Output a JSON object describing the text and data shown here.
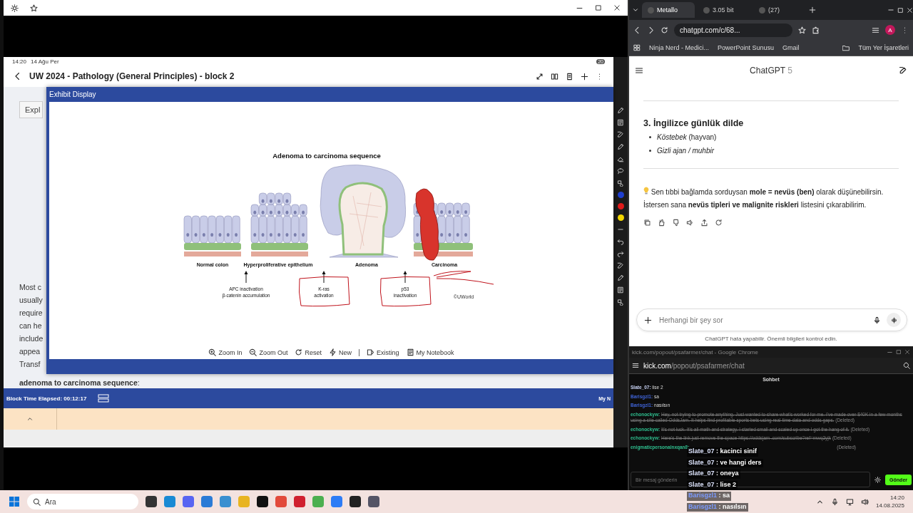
{
  "left_window": {
    "tablet_status": {
      "time": "14:20",
      "date": "14 Ağu Per",
      "battery": "20"
    },
    "app_bar": {
      "title": "UW 2024 - Pathology (General Principles) - block 2"
    },
    "question": {
      "button": "Expl",
      "lines": [
        "Most c",
        "usually",
        "require",
        "can he",
        "include",
        "appea",
        "Transf",
        "**adenoma to carcinoma sequence**:"
      ]
    },
    "exhibit": {
      "title": "Exhibit Display",
      "figure": {
        "title": "Adenoma to carcinoma sequence",
        "stages": [
          {
            "label": "Normal colon",
            "kind": "normal"
          },
          {
            "label": "Hyperproliferative epithelium",
            "kind": "hyperplastic"
          },
          {
            "label": "Adenoma",
            "kind": "adenoma"
          },
          {
            "label": "Carcinoma",
            "kind": "carcinoma"
          }
        ],
        "mutations": [
          {
            "lines": [
              "APC inactivation",
              "β-catenin accumulation"
            ],
            "circled": false
          },
          {
            "lines": [
              "K-ras",
              "activation"
            ],
            "circled": true
          },
          {
            "lines": [
              "p53",
              "inactivation"
            ],
            "circled": true
          }
        ],
        "credit": "©UWorld"
      },
      "toolbar": [
        {
          "label": "Zoom In",
          "kind": "zoom-in"
        },
        {
          "label": "Zoom Out",
          "kind": "zoom-out"
        },
        {
          "label": "Reset",
          "kind": "reset"
        },
        {
          "label": "New",
          "kind": "new"
        },
        {
          "label": "Existing",
          "kind": "existing"
        },
        {
          "label": "My Notebook",
          "kind": "notebook"
        }
      ]
    },
    "footer": {
      "elapsed": "Block Time Elapsed: 00:12:17",
      "right": "My N"
    },
    "pen_colors": [
      {
        "color": "#1f3fd0"
      },
      {
        "color": "#e01b1b"
      },
      {
        "color": "#f2d600"
      }
    ]
  },
  "browser": {
    "tabs": [
      {
        "label": "Metallo",
        "selected": true
      },
      {
        "label": "3.05 bit",
        "selected": false
      },
      {
        "label": "(27)",
        "selected": false
      }
    ],
    "url": "chatgpt.com/c/68...",
    "profile": "A",
    "bookmarks": [
      "Ninja Nerd - Medici...",
      "PowerPoint Sunusu",
      "Gmail"
    ],
    "all_bookmarks": "Tüm Yer İşaretleri"
  },
  "chatgpt": {
    "model": "ChatGPT",
    "version": "5",
    "heading": "3. İngilizce günlük dilde",
    "bullets": [
      {
        "text": "*Köstebek* (hayvan)",
        "italic": false
      },
      {
        "text": "Gizli ajan / muhbir",
        "italic": true
      }
    ],
    "paragraphs": [
      "Sen tıbbi bağlamda sorduysan **mole = nevüs (ben)** olarak düşünebilirsin.",
      "İstersen sana **nevüs tipleri ve malignite riskleri** listesini çıkarabilirim."
    ],
    "input_placeholder": "Herhangi bir şey sor",
    "disclaimer": "ChatGPT hata yapabilir. Önemli bilgileri kontrol edin."
  },
  "kick": {
    "window_title": "kick.com/popout/psafarmer/chat - Google Chrome",
    "url_host": "kick.com",
    "url_path": "/popout/psafarmer/chat",
    "header": "Sohbet",
    "messages": [
      {
        "user": "Slate_07:",
        "text": "lise 2",
        "color": "#c9d3f5",
        "deleted": false
      },
      {
        "user": "Barisgzl1:",
        "text": "sa",
        "color": "#3f63d6",
        "deleted": false
      },
      {
        "user": "Barisgzl1:",
        "text": "nasılsın",
        "color": "#3f63d6",
        "deleted": false
      },
      {
        "user": "echonockyw:",
        "text": "Hey, not trying to promote anything. Just wanted to share what's worked for me. I've made over $40K in a few months using a site called OddsJam. It helps find profitable sports bets using real-time data and odds gaps.",
        "color": "#2fbf8f",
        "deleted": true,
        "label": "(Deleted)"
      },
      {
        "user": "echonockyw:",
        "text": "It's not luck. It's all math and strategy. I started small and scaled up once I got the hang of it.",
        "color": "#2fbf8f",
        "deleted": true,
        "label": "(Deleted)"
      },
      {
        "user": "echonockyw:",
        "text": "Here's the link just remove the space https://oddsjam .com/subscribe?ref=mwq3yjk",
        "color": "#2fbf8f",
        "deleted": true,
        "label": "(Deleted)"
      },
      {
        "user": "enigmaticpersonalnxqan8:",
        "color": "#2fbf8f",
        "label": "(Deleted)"
      }
    ],
    "input_placeholder": "Bir mesaj gönderin",
    "send": "Gönder"
  },
  "overlay": {
    "messages": [
      {
        "user": "Slate_07",
        "separator": ":",
        "text": "kacinci sinif",
        "color": "#dfe6ff"
      },
      {
        "user": "Slate_07",
        "separator": ":",
        "text": "ve hangi ders",
        "color": "#dfe6ff"
      },
      {
        "user": "Slate_07",
        "separator": ":",
        "text": "oneya",
        "color": "#dfe6ff"
      },
      {
        "user": "Slate_07",
        "separator": ":",
        "text": "lise 2",
        "color": "#dfe6ff"
      },
      {
        "user": "Barisgzl1",
        "separator": ":",
        "text": "sa",
        "color": "#7b9bff"
      },
      {
        "user": "Barisgzl1",
        "separator": ":",
        "text": "nasılsın",
        "color": "#7b9bff"
      }
    ]
  },
  "taskbar": {
    "search": "Ara",
    "time": "14:20",
    "date": "14.08.2025"
  }
}
